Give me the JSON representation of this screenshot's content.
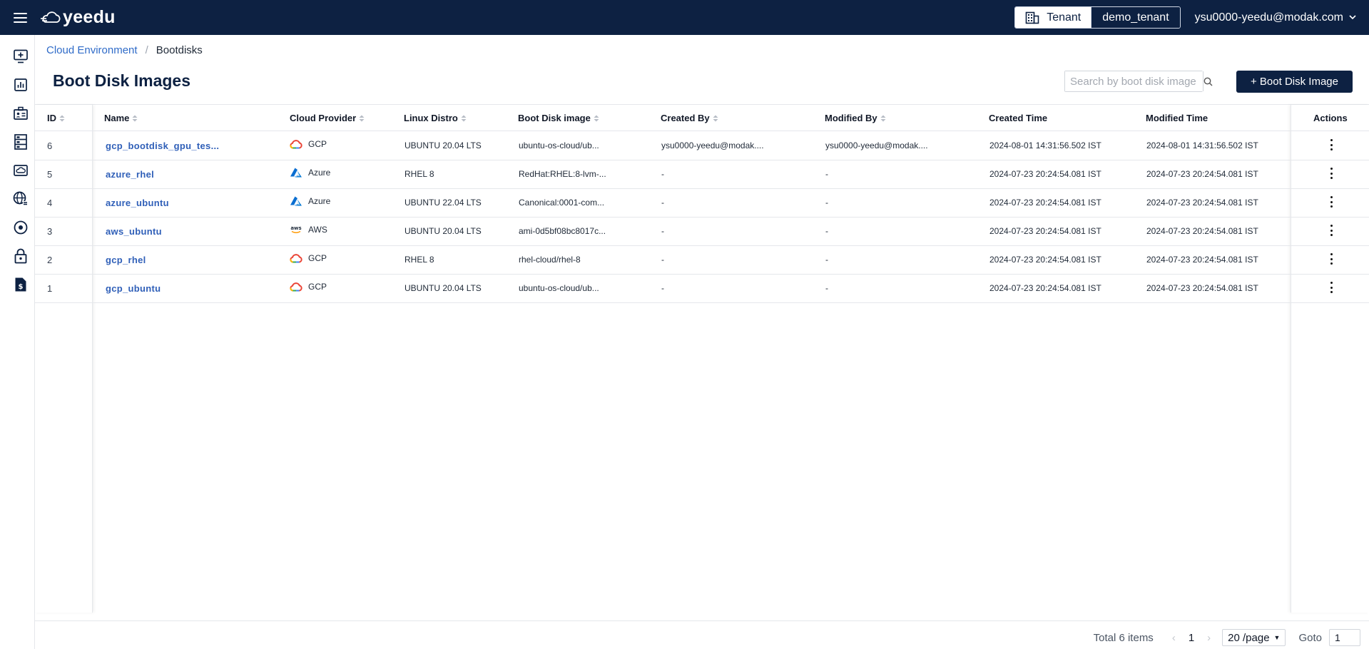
{
  "header": {
    "brand": "yeedu",
    "tenant_label": "Tenant",
    "tenant_value": "demo_tenant",
    "user": "ysu0000-yeedu@modak.com",
    "background_color": "#0d2142"
  },
  "sidebar": {
    "items": [
      {
        "name": "workspace-add-icon"
      },
      {
        "name": "chart-icon"
      },
      {
        "name": "id-card-icon"
      },
      {
        "name": "server-icon"
      },
      {
        "name": "cloud-drive-icon"
      },
      {
        "name": "globe-icon"
      },
      {
        "name": "disk-icon"
      },
      {
        "name": "lock-icon"
      },
      {
        "name": "billing-icon"
      }
    ]
  },
  "breadcrumb": {
    "parent": "Cloud Environment",
    "separator": "/",
    "current": "Bootdisks"
  },
  "page": {
    "title": "Boot Disk Images",
    "search_placeholder": "Search by boot disk image",
    "add_button": "+ Boot Disk Image",
    "accent_color": "#2f5fb8"
  },
  "table": {
    "columns": {
      "id": "ID",
      "name": "Name",
      "cloud_provider": "Cloud Provider",
      "linux_distro": "Linux Distro",
      "boot_disk_image": "Boot Disk image",
      "created_by": "Created By",
      "modified_by": "Modified By",
      "created_time": "Created Time",
      "modified_time": "Modified Time",
      "actions": "Actions"
    },
    "rows": [
      {
        "id": "6",
        "name": "gcp_bootdisk_gpu_tes...",
        "provider": "GCP",
        "distro": "UBUNTU 20.04 LTS",
        "image": "ubuntu-os-cloud/ub...",
        "created_by": "ysu0000-yeedu@modak....",
        "modified_by": "ysu0000-yeedu@modak....",
        "created_time": "2024-08-01 14:31:56.502 IST",
        "modified_time": "2024-08-01 14:31:56.502 IST"
      },
      {
        "id": "5",
        "name": "azure_rhel",
        "provider": "Azure",
        "distro": "RHEL 8",
        "image": "RedHat:RHEL:8-lvm-...",
        "created_by": "-",
        "modified_by": "-",
        "created_time": "2024-07-23 20:24:54.081 IST",
        "modified_time": "2024-07-23 20:24:54.081 IST"
      },
      {
        "id": "4",
        "name": "azure_ubuntu",
        "provider": "Azure",
        "distro": "UBUNTU 22.04 LTS",
        "image": "Canonical:0001-com...",
        "created_by": "-",
        "modified_by": "-",
        "created_time": "2024-07-23 20:24:54.081 IST",
        "modified_time": "2024-07-23 20:24:54.081 IST"
      },
      {
        "id": "3",
        "name": "aws_ubuntu",
        "provider": "AWS",
        "distro": "UBUNTU 20.04 LTS",
        "image": "ami-0d5bf08bc8017c...",
        "created_by": "-",
        "modified_by": "-",
        "created_time": "2024-07-23 20:24:54.081 IST",
        "modified_time": "2024-07-23 20:24:54.081 IST"
      },
      {
        "id": "2",
        "name": "gcp_rhel",
        "provider": "GCP",
        "distro": "RHEL 8",
        "image": "rhel-cloud/rhel-8",
        "created_by": "-",
        "modified_by": "-",
        "created_time": "2024-07-23 20:24:54.081 IST",
        "modified_time": "2024-07-23 20:24:54.081 IST"
      },
      {
        "id": "1",
        "name": "gcp_ubuntu",
        "provider": "GCP",
        "distro": "UBUNTU 20.04 LTS",
        "image": "ubuntu-os-cloud/ub...",
        "created_by": "-",
        "modified_by": "-",
        "created_time": "2024-07-23 20:24:54.081 IST",
        "modified_time": "2024-07-23 20:24:54.081 IST"
      }
    ]
  },
  "pagination": {
    "total": "Total 6 items",
    "current_page": "1",
    "page_size": "20 /page",
    "goto_label": "Goto",
    "goto_value": "1"
  }
}
